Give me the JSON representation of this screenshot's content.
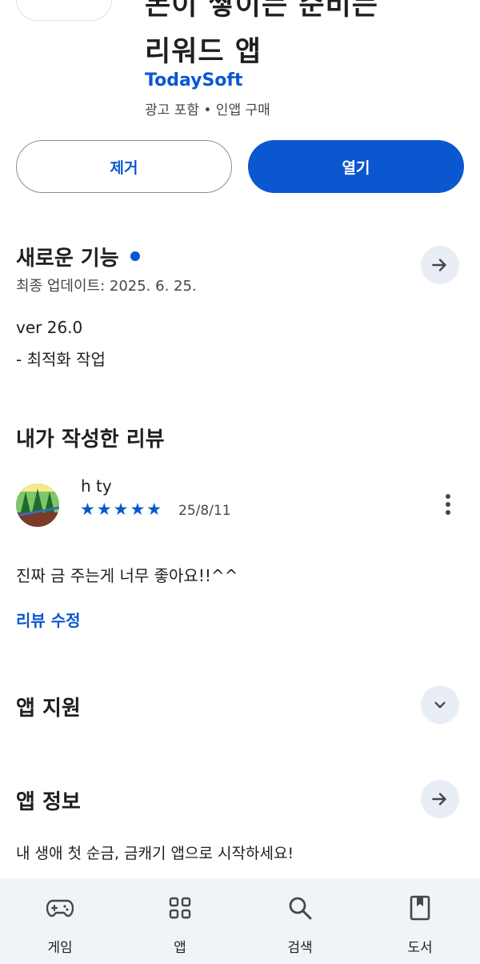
{
  "app": {
    "title_line1": "돈이 쌓이는 순비는",
    "title_line2": "리워드 앱",
    "developer": "TodaySoft",
    "meta": "광고 포함 • 인앱 구매"
  },
  "actions": {
    "remove_label": "제거",
    "open_label": "열기"
  },
  "whats_new": {
    "title": "새로운 기능",
    "last_updated": "최종 업데이트: 2025. 6. 25.",
    "version": "ver 26.0",
    "note": "- 최적화 작업"
  },
  "my_review": {
    "title": "내가 작성한 리뷰",
    "reviewer": "h ty",
    "stars": "★★★★★",
    "rating": 5,
    "date": "25/8/11",
    "text": "진짜 금 주는게 너무 좋아요!!^^",
    "edit_label": "리뷰 수정"
  },
  "app_support": {
    "title": "앱 지원"
  },
  "app_info": {
    "title": "앱 정보",
    "description": "내 생애 첫 순금, 금캐기 앱으로 시작하세요!"
  },
  "bottom_nav": {
    "items": [
      {
        "label": "게임",
        "icon": "gamepad-icon"
      },
      {
        "label": "앱",
        "icon": "apps-grid-icon"
      },
      {
        "label": "검색",
        "icon": "search-icon"
      },
      {
        "label": "도서",
        "icon": "book-icon"
      }
    ]
  },
  "colors": {
    "accent": "#0b57d0",
    "round_button_bg": "#e9eef6",
    "nav_bg": "#f0f4f9"
  }
}
